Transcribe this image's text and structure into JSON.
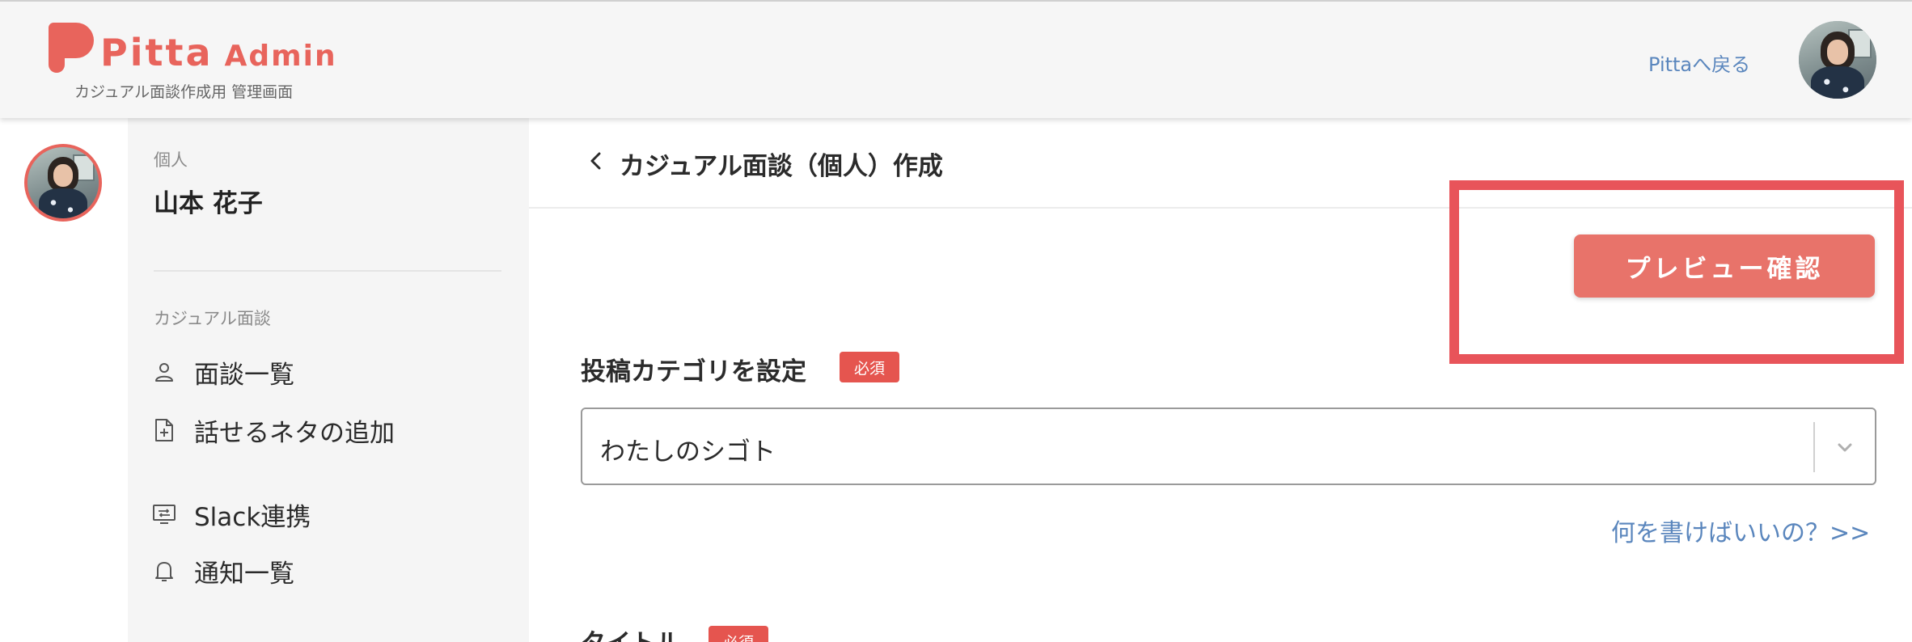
{
  "header": {
    "logo_text": "Pitta",
    "logo_admin": "Admin",
    "logo_subtitle": "カジュアル面談作成用 管理画面",
    "back_link": "Pittaへ戻る",
    "avatar_icon": "user-photo"
  },
  "sidebar": {
    "section_individual": "個人",
    "user_name": "山本 花子",
    "section_casual": "カジュアル面談",
    "items": [
      {
        "label": "面談一覧",
        "icon": "person-icon"
      },
      {
        "label": "話せるネタの追加",
        "icon": "add-document-icon"
      },
      {
        "label": "Slack連携",
        "icon": "slack-integration-icon"
      },
      {
        "label": "通知一覧",
        "icon": "bell-icon"
      }
    ]
  },
  "main": {
    "page_title": "カジュアル面談（個人）作成",
    "preview_button": "プレビュー確認",
    "category_label": "投稿カテゴリを設定",
    "required_badge": "必須",
    "category_value": "わたしのシゴト",
    "help_link": "何を書けばいいの？>>",
    "title_label": "タイトル"
  },
  "colors": {
    "brand": "#e8645c",
    "button": "#e8736a",
    "badge": "#e5554f",
    "link": "#5a86bd",
    "highlight": "#e8545a"
  }
}
